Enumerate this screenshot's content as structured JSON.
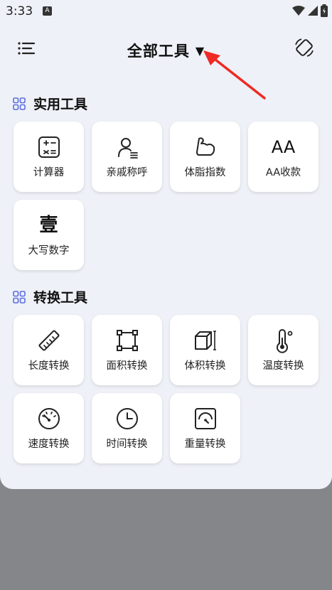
{
  "statusbar": {
    "time": "3:33",
    "notif_icon": "A"
  },
  "header": {
    "title": "全部工具",
    "dropdown_arrow": "▼"
  },
  "sections": [
    {
      "title": "实用工具",
      "items": [
        {
          "label": "计算器",
          "icon": "calculator-icon"
        },
        {
          "label": "亲戚称呼",
          "icon": "person-list-icon"
        },
        {
          "label": "体脂指数",
          "icon": "arm-muscle-icon"
        },
        {
          "label": "AA收款",
          "icon": "aa-letters-icon",
          "glyph": "AA"
        },
        {
          "label": "大写数字",
          "icon": "chinese-numeral-icon",
          "glyph": "壹"
        }
      ]
    },
    {
      "title": "转换工具",
      "items": [
        {
          "label": "长度转换",
          "icon": "ruler-icon"
        },
        {
          "label": "面积转换",
          "icon": "area-square-icon"
        },
        {
          "label": "体积转换",
          "icon": "cube-icon"
        },
        {
          "label": "温度转换",
          "icon": "thermometer-icon"
        },
        {
          "label": "速度转换",
          "icon": "speedometer-icon"
        },
        {
          "label": "时间转换",
          "icon": "clock-icon"
        },
        {
          "label": "重量转换",
          "icon": "scale-icon"
        }
      ]
    }
  ],
  "colors": {
    "accent": "#5b6ee1",
    "annotation_arrow": "#ee2a24",
    "sheet": "#eef1f7"
  }
}
